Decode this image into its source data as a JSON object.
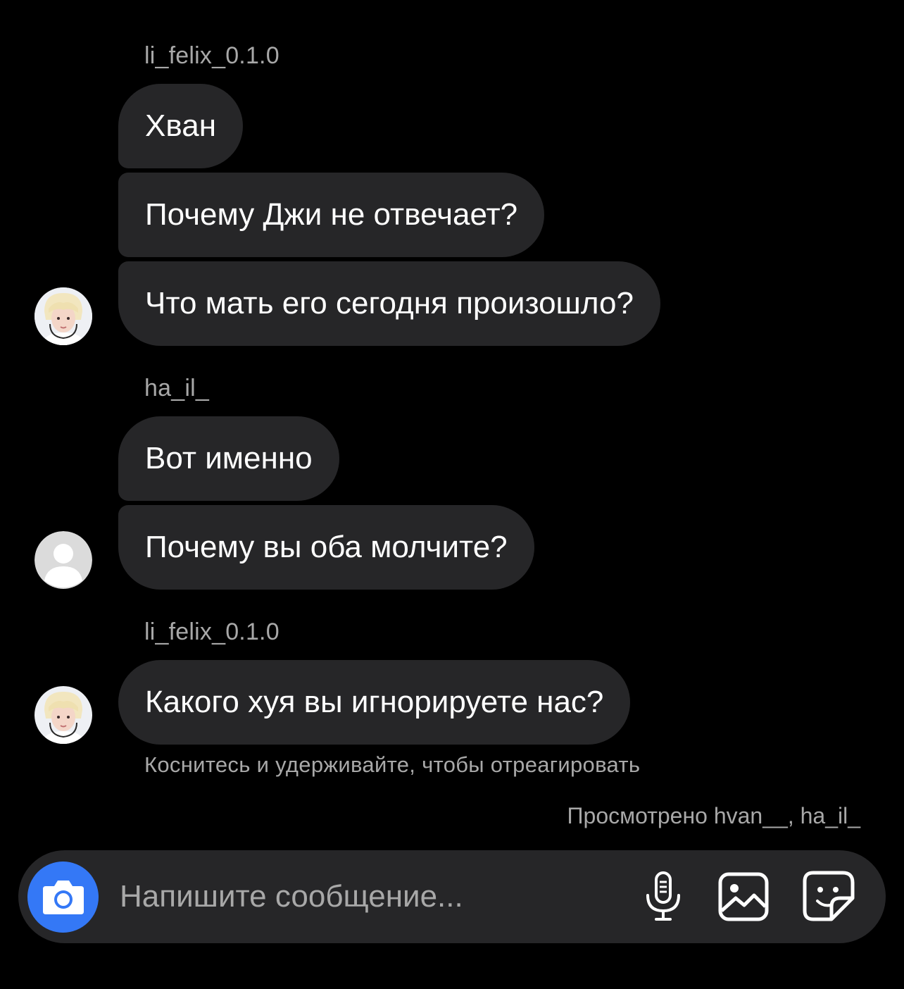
{
  "conversation": {
    "groups": [
      {
        "sender": "li_felix_0.1.0",
        "avatar": "photo-avatar",
        "messages": [
          "Хван",
          "Почему Джи не отвечает?",
          "Что мать его сегодня произошло?"
        ]
      },
      {
        "sender": "ha_il_",
        "avatar": "default-avatar",
        "messages": [
          "Вот именно",
          "Почему вы оба молчите?"
        ]
      },
      {
        "sender": "li_felix_0.1.0",
        "avatar": "photo-avatar",
        "messages": [
          "Какого хуя вы игнорируете нас?"
        ]
      }
    ],
    "reaction_hint": "Коснитесь и удерживайте, чтобы отреагировать",
    "seen_by": "Просмотрено hvan__, ha_il_"
  },
  "composer": {
    "placeholder": "Напишите сообщение...",
    "value": "",
    "icons": {
      "camera": "camera-icon",
      "microphone": "microphone-icon",
      "gallery": "gallery-icon",
      "sticker": "sticker-icon"
    }
  },
  "colors": {
    "background": "#000000",
    "bubble": "#262628",
    "secondary_text": "#a8a8a8",
    "accent": "#3478f6"
  }
}
